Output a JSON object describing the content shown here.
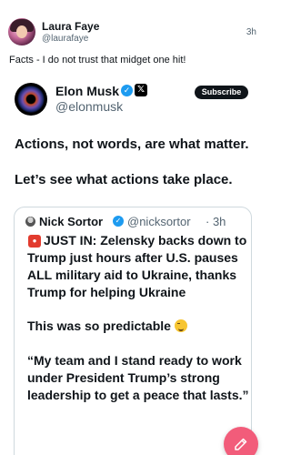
{
  "post": {
    "author_name": "Laura Faye",
    "author_handle": "@laurafaye",
    "time": "3h",
    "text": "Facts - I do not trust that midget one hit!"
  },
  "embedded_tweet": {
    "author_name": "Elon Musk",
    "author_handle": "@elonmusk",
    "subscribe_label": "Subscribe",
    "line1": "Actions, not words, are what matter.",
    "line2": "Let’s see what actions take place.",
    "quoted": {
      "author_name": "Nick Sortor",
      "author_handle": "@nicksortor",
      "time": "· 3h",
      "body": "JUST IN: Zelensky backs down to Trump just hours after U.S. pauses ALL military aid to Ukraine, thanks Trump for helping Ukraine",
      "predict": "This was so predictable",
      "quote": "“My team and I stand ready to work under President Trump’s strong leadership to get a peace that lasts.”"
    }
  },
  "colors": {
    "verified_blue": "#1d9bf0",
    "compose_pink": "#f25c7a",
    "siren_red": "#e23b2e"
  },
  "icons": {
    "verified": "verified-check-icon",
    "x_logo": "x-logo-icon",
    "siren": "siren-emoji-icon",
    "laughing": "rofl-emoji-icon",
    "compose": "compose-icon"
  }
}
